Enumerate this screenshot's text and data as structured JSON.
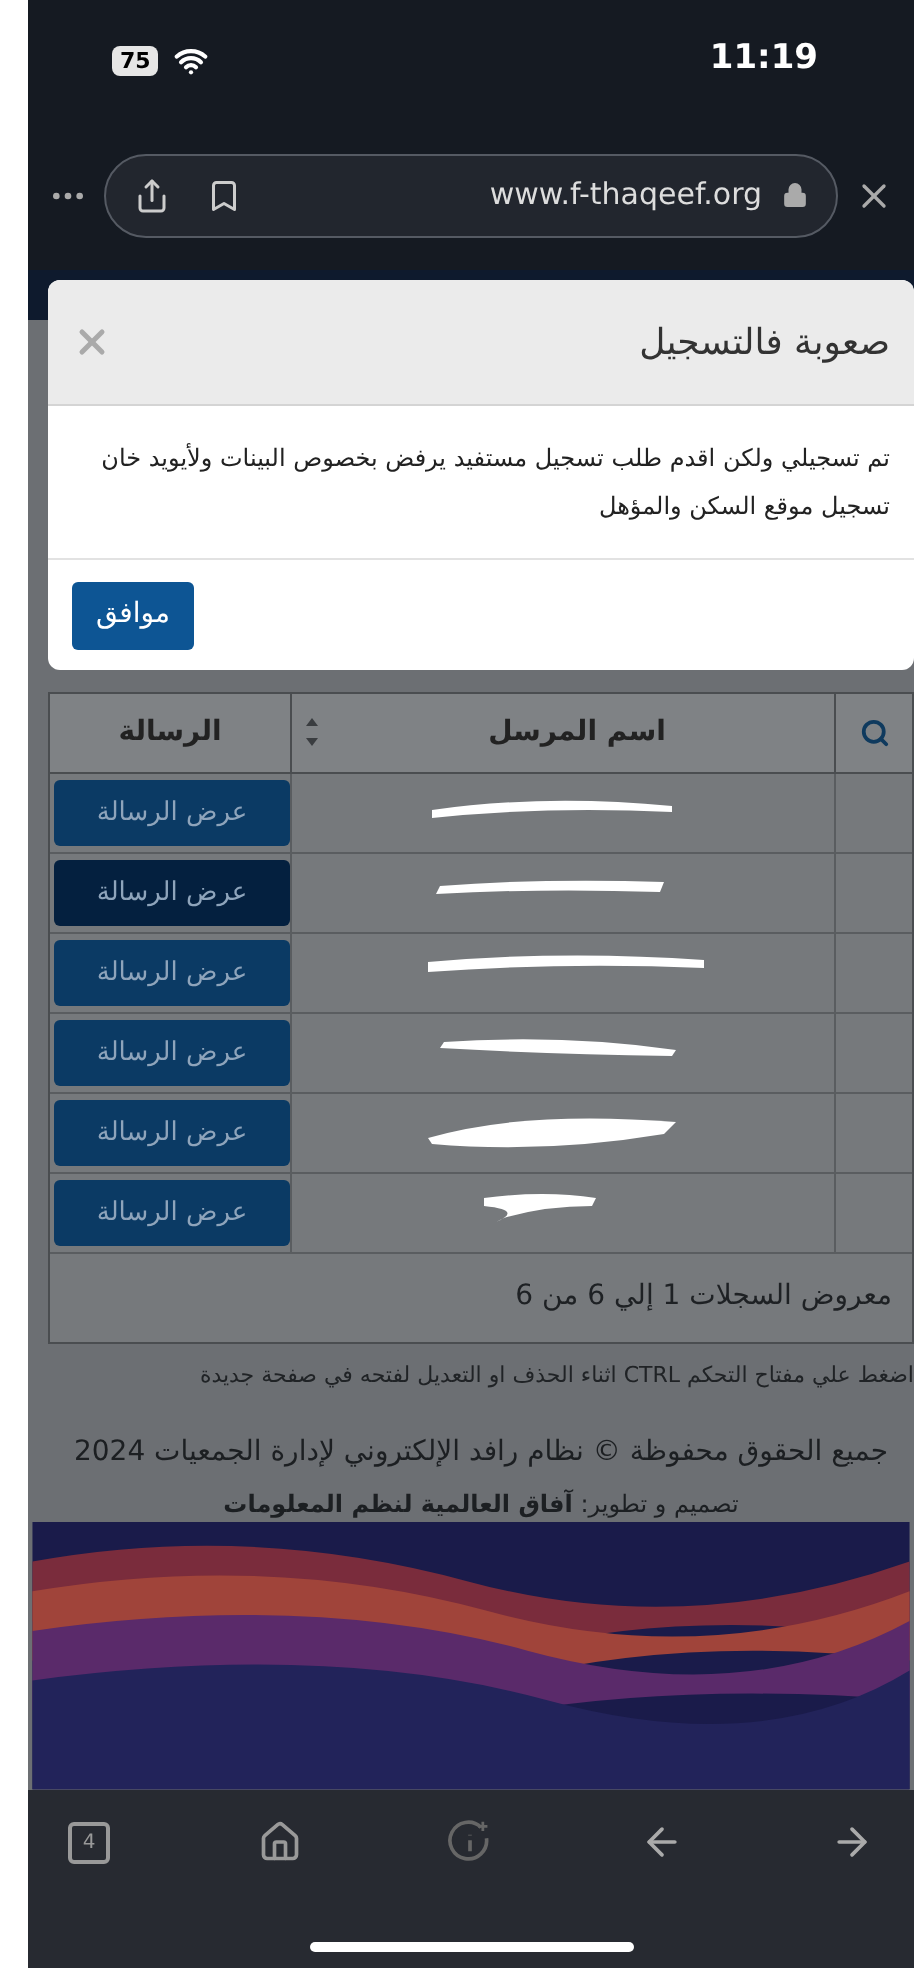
{
  "status_bar": {
    "battery": "75",
    "time": "11:19"
  },
  "browser": {
    "url": "www.f-thaqeef.org",
    "tab_count": "4"
  },
  "modal": {
    "title": "صعوبة فالتسجيل",
    "message": "تم تسجيلي ولكن اقدم طلب تسجيل مستفيد يرفض بخصوص البينات ولأيويد خان تسجيل موقع السكن والمؤهل",
    "button": "موافق"
  },
  "table": {
    "columns": [
      "اسم المرسل",
      "الرسالة"
    ],
    "rows": [
      {
        "action": "عرض الرسالة",
        "active": false
      },
      {
        "action": "عرض الرسالة",
        "active": true
      },
      {
        "action": "عرض الرسالة",
        "active": false
      },
      {
        "action": "عرض الرسالة",
        "active": false
      },
      {
        "action": "عرض الرسالة",
        "active": false
      },
      {
        "action": "عرض الرسالة",
        "active": false
      }
    ],
    "info": "معروض السجلات 1 إلي 6 من 6"
  },
  "hint": "اضغط علي مفتاح التحكم CTRL اثناء الحذف او التعديل لفتحه في صفحة جديدة",
  "footer": {
    "copyright": "جميع الحقوق محفوظة © نظام رافد الإلكتروني لإدارة الجمعيات 2024",
    "credit": "تصميم و تطوير: **آفاق العالمية لنظم المعلومات**"
  }
}
